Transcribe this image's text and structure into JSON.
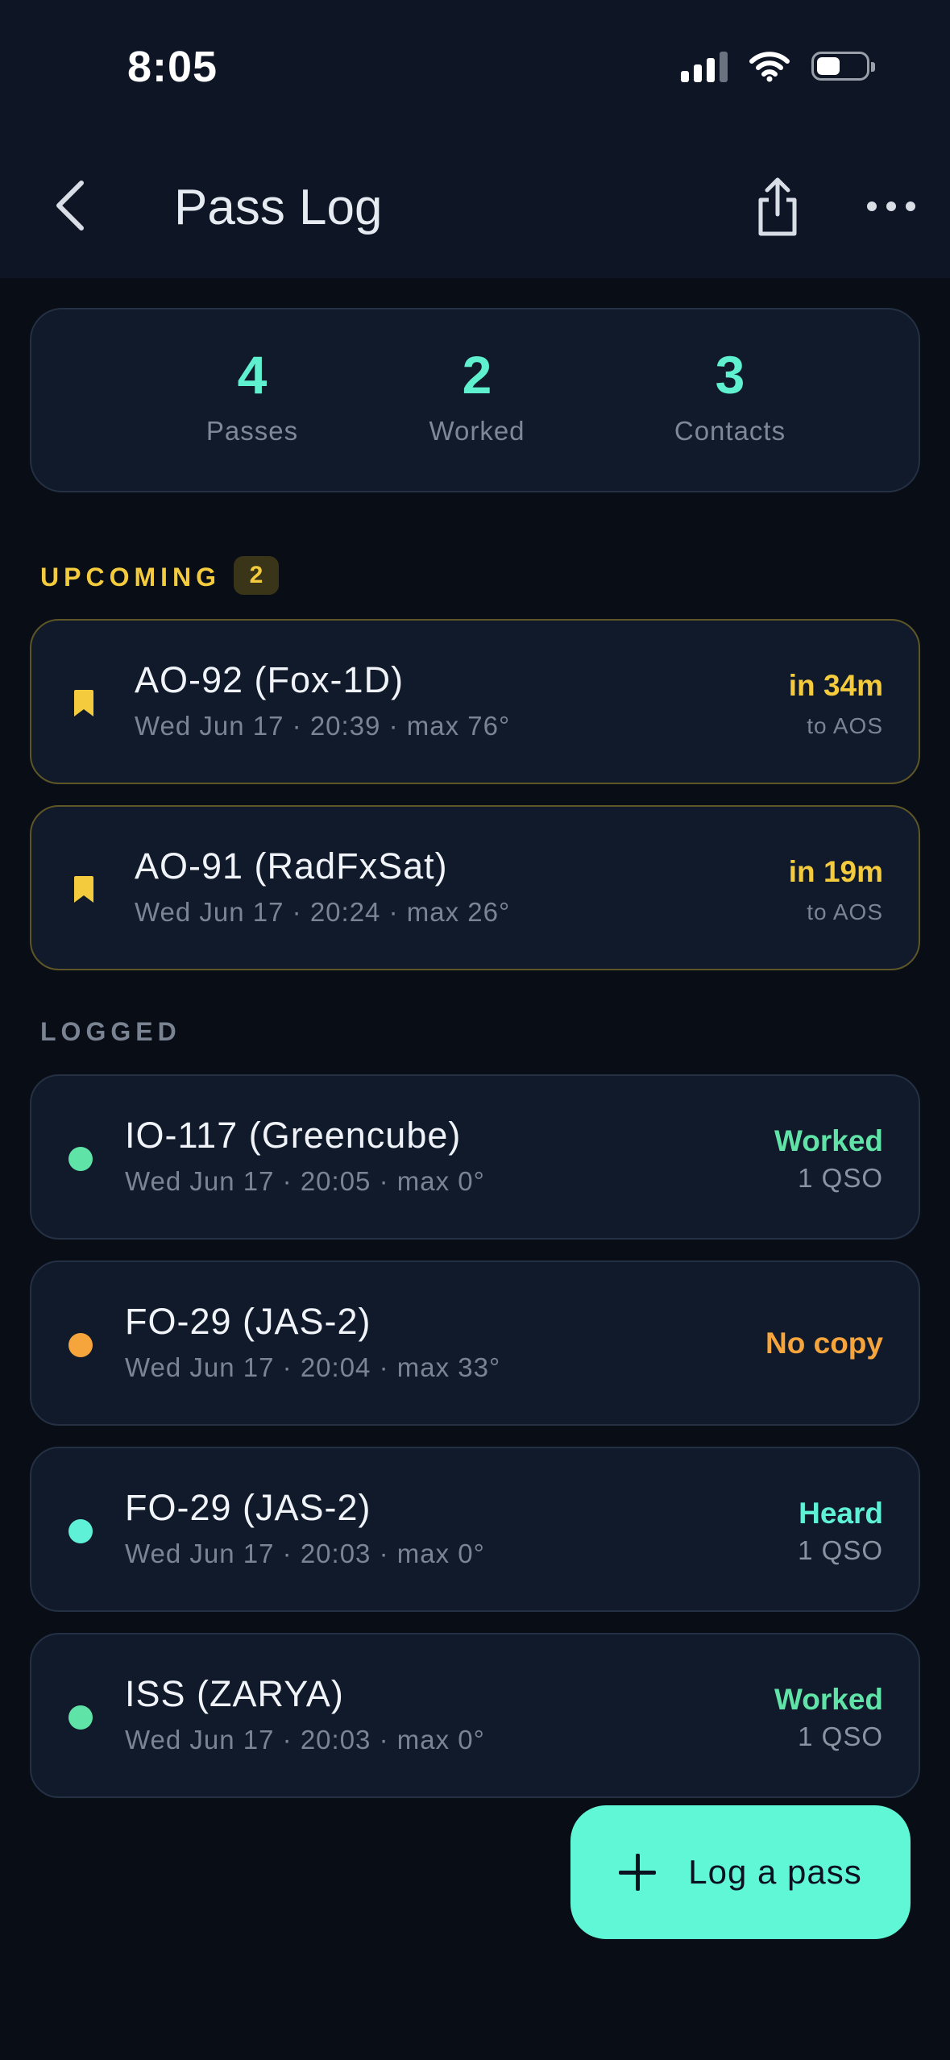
{
  "status_bar": {
    "time": "8:05"
  },
  "header": {
    "title": "Pass Log"
  },
  "summary": [
    {
      "value": "4",
      "label": "Passes"
    },
    {
      "value": "2",
      "label": "Worked"
    },
    {
      "value": "3",
      "label": "Contacts"
    }
  ],
  "upcoming": {
    "heading": "UPCOMING",
    "count": "2",
    "items": [
      {
        "name": "AO-92 (Fox-1D)",
        "meta": "Wed Jun 17 · 20:39 · max 76°",
        "eta": "in 34m",
        "eta_label": "to AOS"
      },
      {
        "name": "AO-91 (RadFxSat)",
        "meta": "Wed Jun 17 · 20:24 · max 26°",
        "eta": "in 19m",
        "eta_label": "to AOS"
      }
    ]
  },
  "logged": {
    "heading": "LOGGED",
    "items": [
      {
        "name": "IO-117 (Greencube)",
        "meta": "Wed Jun 17 · 20:05 · max 0°",
        "status": "Worked",
        "qso": "1 QSO",
        "status_color": "#5fe3a6"
      },
      {
        "name": "FO-29 (JAS-2)",
        "meta": "Wed Jun 17 · 20:04 · max 33°",
        "status": "No copy",
        "qso": "",
        "status_color": "#f6a43c"
      },
      {
        "name": "FO-29 (JAS-2)",
        "meta": "Wed Jun 17 · 20:03 · max 0°",
        "status": "Heard",
        "qso": "1 QSO",
        "status_color": "#5ff0d8"
      },
      {
        "name": "ISS (ZARYA)",
        "meta": "Wed Jun 17 · 20:03 · max 0°",
        "status": "Worked",
        "qso": "1 QSO",
        "status_color": "#5fe3a6"
      }
    ]
  },
  "fab": {
    "label": "Log a pass",
    "icon": "plus-icon"
  },
  "colors": {
    "accent": "#5ff7d6",
    "upcoming": "#f4cb3c",
    "worked": "#5fe3a6",
    "no_copy": "#f6a43c",
    "heard": "#5ff0d8"
  }
}
